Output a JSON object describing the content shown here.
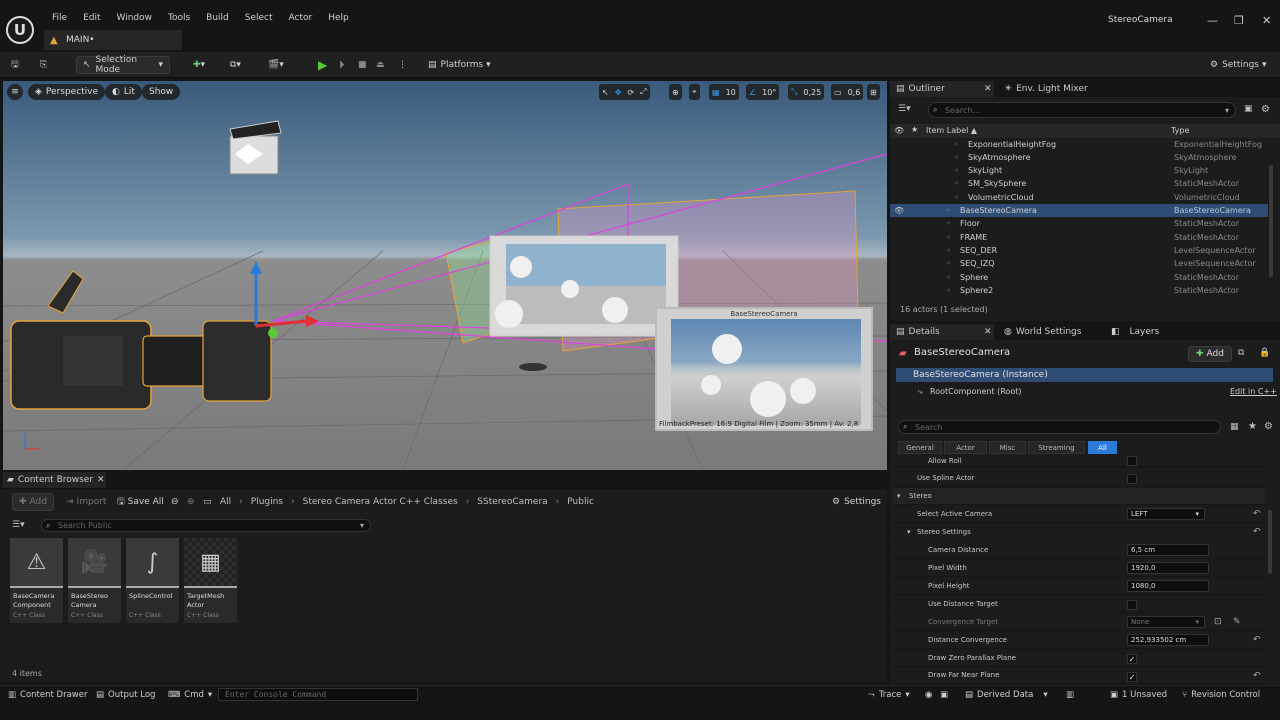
{
  "window": {
    "app_name": "StereoCamera",
    "level_tab": "MAIN•",
    "logo": "U"
  },
  "menu": [
    "File",
    "Edit",
    "Window",
    "Tools",
    "Build",
    "Select",
    "Actor",
    "Help"
  ],
  "toolbar": {
    "selection_mode": "Selection Mode",
    "platforms": "Platforms",
    "settings": "Settings"
  },
  "viewport": {
    "perspective": "Perspective",
    "lit": "Lit",
    "show": "Show",
    "grid_snap": "10",
    "rotation_snap": "10°",
    "scale_snap": "0,25",
    "camera_speed": "0,6",
    "pip_title": "BaseStereoCamera",
    "pip_caption": "FilmbackPreset: 16:9 Digital Film | Zoom: 35mm | Av: 2,8"
  },
  "outliner": {
    "tabs": [
      "Outliner",
      "Env. Light Mixer"
    ],
    "search_placeholder": "Search...",
    "col_label": "Item Label ▲",
    "col_type": "Type",
    "rows": [
      {
        "label": "ExponentialHeightFog",
        "type": "ExponentialHeightFog"
      },
      {
        "label": "SkyAtmosphere",
        "type": "SkyAtmosphere"
      },
      {
        "label": "SkyLight",
        "type": "SkyLight"
      },
      {
        "label": "SM_SkySphere",
        "type": "StaticMeshActor"
      },
      {
        "label": "VolumetricCloud",
        "type": "VolumetricCloud"
      },
      {
        "label": "BaseStereoCamera",
        "type": "BaseStereoCamera"
      },
      {
        "label": "Floor",
        "type": "StaticMeshActor"
      },
      {
        "label": "FRAME",
        "type": "StaticMeshActor"
      },
      {
        "label": "SEQ_DER",
        "type": "LevelSequenceActor"
      },
      {
        "label": "SEQ_IZQ",
        "type": "LevelSequenceActor"
      },
      {
        "label": "Sphere",
        "type": "StaticMeshActor"
      },
      {
        "label": "Sphere2",
        "type": "StaticMeshActor"
      }
    ],
    "count": "16 actors (1 selected)"
  },
  "details": {
    "tabs": [
      "Details",
      "World Settings",
      "Layers"
    ],
    "title": "BaseStereoCamera",
    "add": "Add",
    "instance": "BaseStereoCamera (Instance)",
    "root": "RootComponent (Root)",
    "edit_cpp": "Edit in C++",
    "search_placeholder": "Search",
    "filters": [
      "General",
      "Actor",
      "Misc",
      "Streaming",
      "All"
    ],
    "props": {
      "allow_roll": "Allow Roll",
      "use_spline_actor": "Use Spline Actor",
      "stereo": "Stereo",
      "select_active_camera": "Select Active Camera",
      "select_active_camera_value": "LEFT",
      "stereo_settings": "Stereo Settings",
      "camera_distance": "Camera Distance",
      "camera_distance_value": "6,5 cm",
      "pixel_width": "Pixel Width",
      "pixel_width_value": "1920,0",
      "pixel_height": "Pixel Height",
      "pixel_height_value": "1080,0",
      "use_distance_target": "Use Distance Target",
      "convergence_target": "Convergence Target",
      "convergence_target_value": "None",
      "distance_convergence": "Distance Convergence",
      "distance_convergence_value": "252,933502 cm",
      "draw_zero_parallax": "Draw Zero Parallax Plane",
      "draw_far_near": "Draw Far Near Plane"
    }
  },
  "content_browser": {
    "tab": "Content Browser",
    "add": "Add",
    "import": "Import",
    "save_all": "Save All",
    "breadcrumb": [
      "All",
      "Plugins",
      "Stereo Camera Actor C++ Classes",
      "SStereoCamera",
      "Public"
    ],
    "settings": "Settings",
    "search_placeholder": "Search Public",
    "assets": [
      {
        "name": "BaseCamera Component",
        "cls": "C++ Class"
      },
      {
        "name": "BaseStereo Camera",
        "cls": "C++ Class"
      },
      {
        "name": "SplineControl",
        "cls": "C++ Class"
      },
      {
        "name": "TargetMesh Actor",
        "cls": "C++ Class"
      }
    ],
    "count": "4 items"
  },
  "statusbar": {
    "content_drawer": "Content Drawer",
    "output_log": "Output Log",
    "cmd": "Cmd",
    "console_placeholder": "Enter Console Command",
    "trace": "Trace",
    "derived_data": "Derived Data",
    "unsaved": "1 Unsaved",
    "revision_control": "Revision Control"
  }
}
